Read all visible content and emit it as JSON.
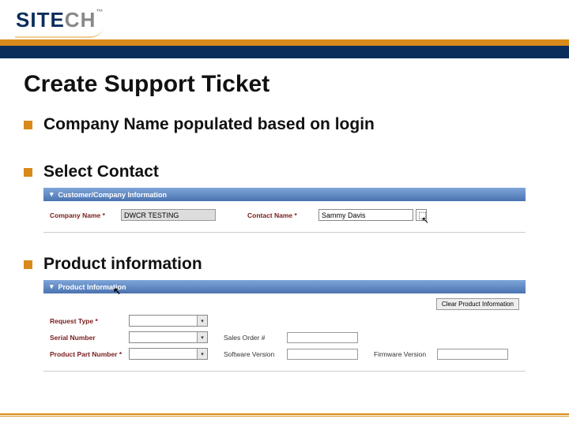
{
  "logo": {
    "text_bold": "SITE",
    "text_gray": "CH",
    "tm": "™"
  },
  "title": "Create Support Ticket",
  "bullets": {
    "b1": "Company Name populated based on login",
    "b2": "Select Contact",
    "b3": "Product information"
  },
  "panel1": {
    "header": "Customer/Company Information",
    "company_label": "Company Name",
    "company_value": "DWCR TESTING",
    "contact_label": "Contact Name",
    "contact_value": "Sammy Davis"
  },
  "panel2": {
    "header": "Product Information",
    "clear_btn": "Clear Product Information",
    "request_type_label": "Request Type",
    "serial_label": "Serial Number",
    "sales_order_label": "Sales Order #",
    "part_label": "Product Part Number",
    "software_label": "Software Version",
    "firmware_label": "Firmware Version"
  }
}
